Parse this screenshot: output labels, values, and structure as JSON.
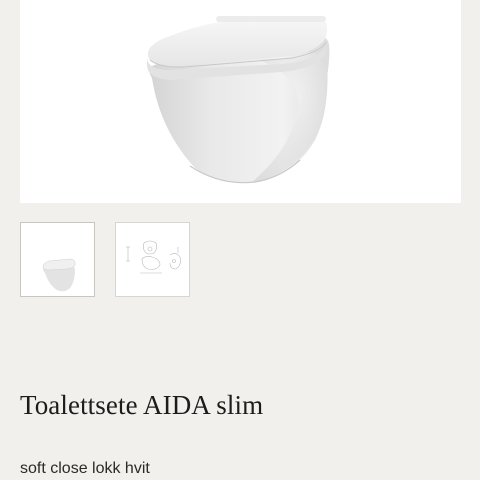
{
  "product": {
    "title": "Toalettsete AIDA slim",
    "subtitle": "soft close lokk hvit"
  },
  "gallery": {
    "main_image": "wall-hung-toilet-product-image",
    "thumbnails": [
      {
        "name": "toilet-photo-thumbnail",
        "selected": true
      },
      {
        "name": "technical-drawing-thumbnail",
        "selected": false
      }
    ]
  },
  "colors": {
    "page_background": "#f2f0ec",
    "image_background": "#ffffff",
    "text": "#1c1c1c"
  }
}
